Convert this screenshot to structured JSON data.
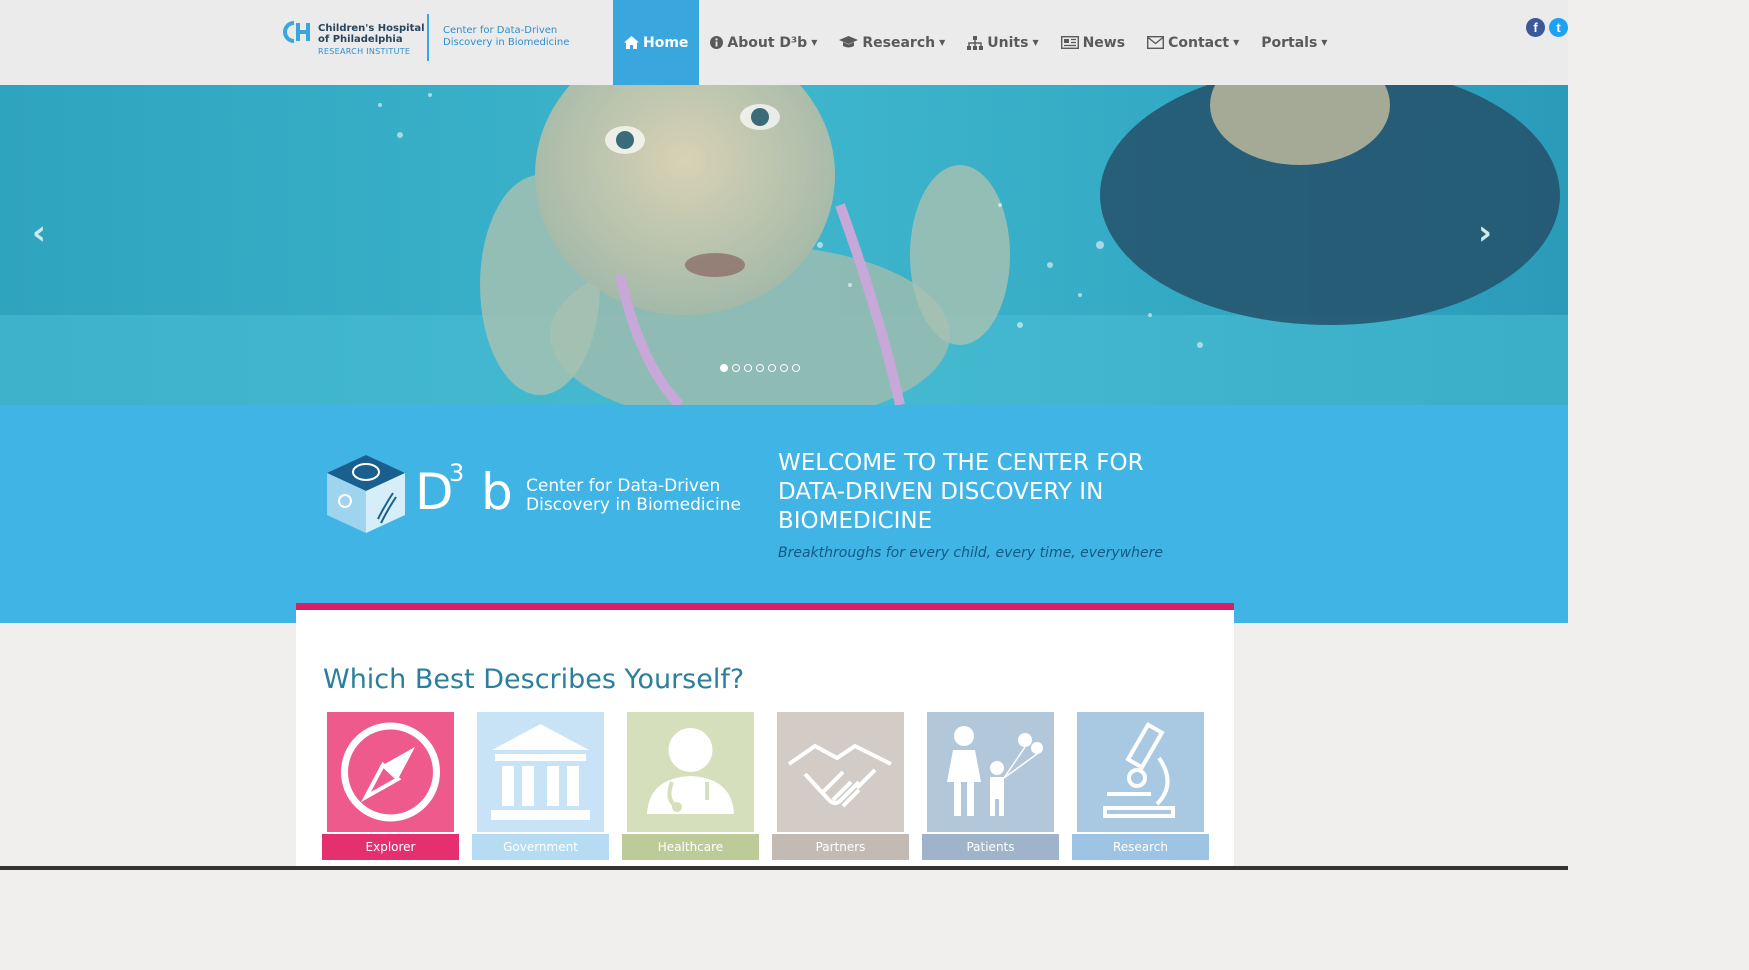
{
  "header": {
    "chop_logo": {
      "line1": "Children's Hospital",
      "line2": "of Philadelphia",
      "line3": "RESEARCH INSTITUTE"
    },
    "center_name_line1": "Center for Data-Driven",
    "center_name_line2": "Discovery in Biomedicine",
    "nav": [
      {
        "label": "Home",
        "icon": "home-icon",
        "active": true
      },
      {
        "label": "About D³b",
        "icon": "info-icon",
        "dropdown": true
      },
      {
        "label": "Research",
        "icon": "graduation-cap-icon",
        "dropdown": true
      },
      {
        "label": "Units",
        "icon": "sitemap-icon",
        "dropdown": true
      },
      {
        "label": "News",
        "icon": "newspaper-icon"
      },
      {
        "label": "Contact",
        "icon": "envelope-icon",
        "dropdown": true
      },
      {
        "label": "Portals",
        "dropdown": true
      }
    ],
    "social": [
      {
        "name": "facebook-icon",
        "glyph": "f",
        "color": "#3b5998"
      },
      {
        "name": "twitter-icon",
        "glyph": "t",
        "color": "#1da1f2"
      }
    ]
  },
  "carousel": {
    "prev_glyph": "‹",
    "next_glyph": "›",
    "slide_count": 7,
    "active_slide": 1
  },
  "welcome": {
    "logo_d": "D",
    "logo_sup": "3",
    "logo_b": "b",
    "logo_caption_line1": "Center for Data-Driven",
    "logo_caption_line2": "Discovery in Biomedicine",
    "heading": "WELCOME TO THE CENTER FOR DATA-DRIVEN DISCOVERY IN BIOMEDICINE",
    "tagline": "Breakthroughs for every child, every time, everywhere"
  },
  "audience": {
    "title": "Which Best Describes Yourself?",
    "tiles": [
      {
        "label": "Explorer",
        "icon": "compass-icon",
        "bg": "#ef5a8c",
        "label_bg": "#e4306f"
      },
      {
        "label": "Government",
        "icon": "government-building-icon",
        "bg": "#c7e3f5",
        "label_bg": "#b5dcf2"
      },
      {
        "label": "Healthcare",
        "icon": "doctor-icon",
        "bg": "#d5dfbb",
        "label_bg": "#bccb98"
      },
      {
        "label": "Partners",
        "icon": "handshake-icon",
        "bg": "#d3cbc6",
        "label_bg": "#c4bab4"
      },
      {
        "label": "Patients",
        "icon": "family-icon",
        "bg": "#b3c7da",
        "label_bg": "#9fb4ca"
      },
      {
        "label": "Research",
        "icon": "microscope-icon",
        "bg": "#a9c8e2",
        "label_bg": "#9dc3e5"
      }
    ]
  },
  "colors": {
    "accent_blue": "#3aa6de",
    "band_blue": "#40b4e5",
    "card_border_pink": "#d81e64"
  }
}
